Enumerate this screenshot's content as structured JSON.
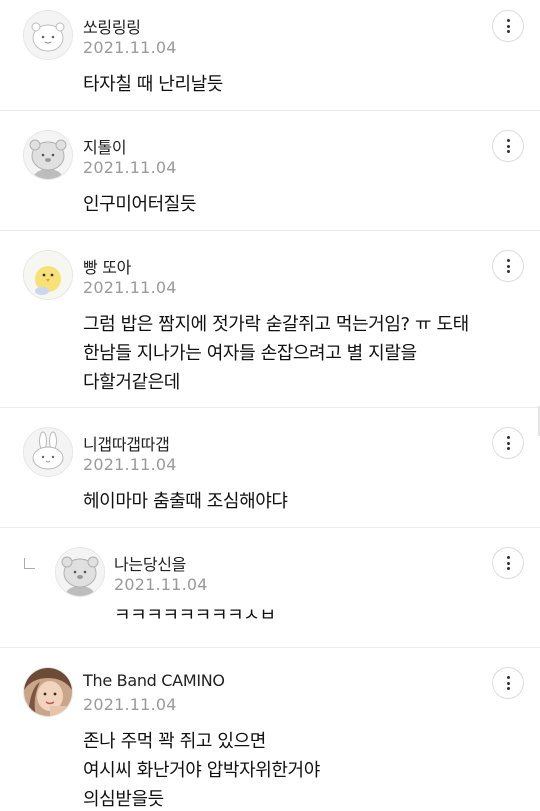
{
  "comments": [
    {
      "author": "쏘링링링",
      "date": "2021.11.04",
      "lines": [
        "타자칠 때 난리날듯"
      ],
      "avatar_icon": "hamster-avatar-icon"
    },
    {
      "author": "지톨이",
      "date": "2021.11.04",
      "lines": [
        "인구미어터질듯"
      ],
      "avatar_icon": "bear-avatar-icon"
    },
    {
      "author": "빵 또아",
      "date": "2021.11.04",
      "lines": [
        "그럼 밥은 짬지에 젓가락 숟갈쥐고 먹는거임? ㅠ 도태",
        "한남들 지나가는 여자들 손잡으려고 별 지랄을",
        "다할거같은데"
      ],
      "avatar_icon": "chick-avatar-icon"
    },
    {
      "author": "니갭따갭따갭",
      "date": "2021.11.04",
      "lines": [
        "헤이마마 춤출때 조심해야댜"
      ],
      "avatar_icon": "bunny-avatar-icon"
    },
    {
      "author": "나는당신을",
      "date": "2021.11.04",
      "lines": [
        "ㅋㅋㅋㅋㅋㅋㅋㅋㅅㅂ"
      ],
      "avatar_icon": "bear-avatar-icon",
      "reply": true
    },
    {
      "author": "The Band CAMINO",
      "date": "2021.11.04",
      "lines": [
        "존나 주먹 꽉 쥐고 있으면",
        "여시씨 화난거야 압박자위한거야",
        "의심받을듯"
      ],
      "avatar_icon": "profile-photo-avatar"
    }
  ],
  "colors": {
    "divider": "#ececec",
    "date": "#9a9a9a",
    "text": "#111111"
  }
}
